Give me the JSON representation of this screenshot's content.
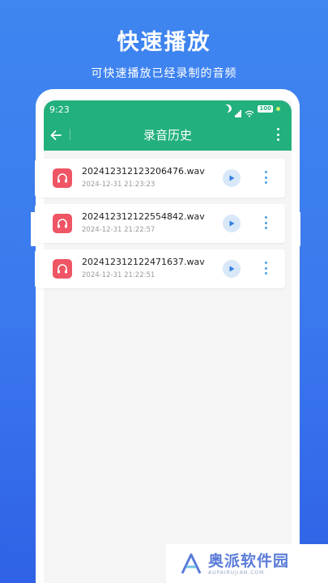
{
  "promo": {
    "title": "快速播放",
    "subtitle": "可快速播放已经录制的音频"
  },
  "status_bar": {
    "time": "9:23",
    "battery": "100"
  },
  "nav": {
    "title": "录音历史",
    "back_icon": "arrow-left-icon",
    "more_icon": "more-vertical-icon"
  },
  "recordings": [
    {
      "name": "202412312123206476.wav",
      "date": "2024-12-31 21:23:23"
    },
    {
      "name": "202412312122554842.wav",
      "date": "2024-12-31 21:22:57"
    },
    {
      "name": "202412312122471637.wav",
      "date": "2024-12-31 21:22:51"
    }
  ],
  "watermark": {
    "main": "奥派软件园",
    "sub": "AUPAIRUJIAN.COM"
  },
  "colors": {
    "background": "#3a78ee",
    "header": "#22b07d",
    "file_icon": "#ef5565",
    "play_button": "#d9e8f8",
    "accent_blue": "#2f80e0"
  }
}
